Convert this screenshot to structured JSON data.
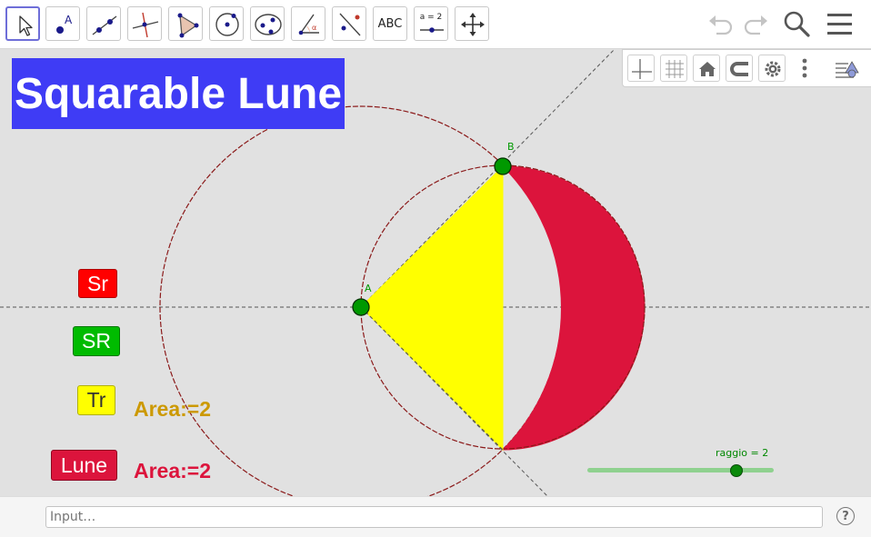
{
  "toolbar": {
    "text_tool_label": "ABC",
    "slider_tool_label": "a = 2"
  },
  "title": "Squarable Lune",
  "points": {
    "a": "A",
    "b": "B"
  },
  "buttons": {
    "sr_small": "Sr",
    "sr_big": "SR",
    "tr": "Tr",
    "lune": "Lune"
  },
  "areas": {
    "triangle": "Area:=2",
    "lune": "Area:=2"
  },
  "slider": {
    "caption": "raggio = 2",
    "min": 0,
    "max": 2.5,
    "value": 2
  },
  "input": {
    "placeholder": "Input…"
  },
  "help_label": "?",
  "colors": {
    "title_bg": "#3f3cf5",
    "lune_fill": "#dc143c",
    "triangle_fill": "#ffff00",
    "point_fill": "#009900",
    "sr_small_bg": "#ff0000",
    "sr_big_bg": "#00bb00",
    "tr_bg": "#ffff00",
    "lune_bg": "#dc143c",
    "triangle_area_text": "#cc9900",
    "lune_area_text": "#dc143c"
  }
}
